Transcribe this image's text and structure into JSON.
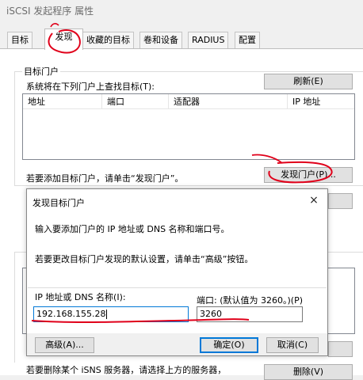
{
  "window": {
    "title": "iSCSI 发起程序 属性"
  },
  "tabs": [
    {
      "label": "目标",
      "active": false
    },
    {
      "label": "发现",
      "active": true
    },
    {
      "label": "收藏的目标",
      "active": false
    },
    {
      "label": "卷和设备",
      "active": false
    },
    {
      "label": "RADIUS",
      "active": false
    },
    {
      "label": "配置",
      "active": false
    }
  ],
  "portals": {
    "group_title": "目标门户",
    "description": "系统将在下列门户上查找目标(T):",
    "refresh_button": "刷新(E)",
    "columns": [
      "地址",
      "端口",
      "适配器",
      "IP 地址"
    ],
    "add_hint": "若要添加目标门户，请单击“发现门户”。",
    "discover_button": "发现门户(P)..."
  },
  "isns": {
    "remove_hint": "若要删除某个 iSNS 服务器，请选择上方的服务器，",
    "remove_button": "删除(V)"
  },
  "dialog": {
    "title": "发现目标门户",
    "close_glyph": "×",
    "instruction": "输入要添加门户的 IP 地址或 DNS 名称和端口号。",
    "change_hint": "若要更改目标门户发现的默认设置，请单击“高级”按钮。",
    "ip_label": "IP 地址或 DNS 名称(I):",
    "ip_value": "192.168.155.28",
    "port_label": "端口: (默认值为 3260。)(P)",
    "port_value": "3260",
    "advanced_button": "高级(A)...",
    "ok_button": "确定(O)",
    "cancel_button": "取消(C)"
  },
  "colors": {
    "annotation": "#e0001a",
    "focus": "#0078d7"
  }
}
